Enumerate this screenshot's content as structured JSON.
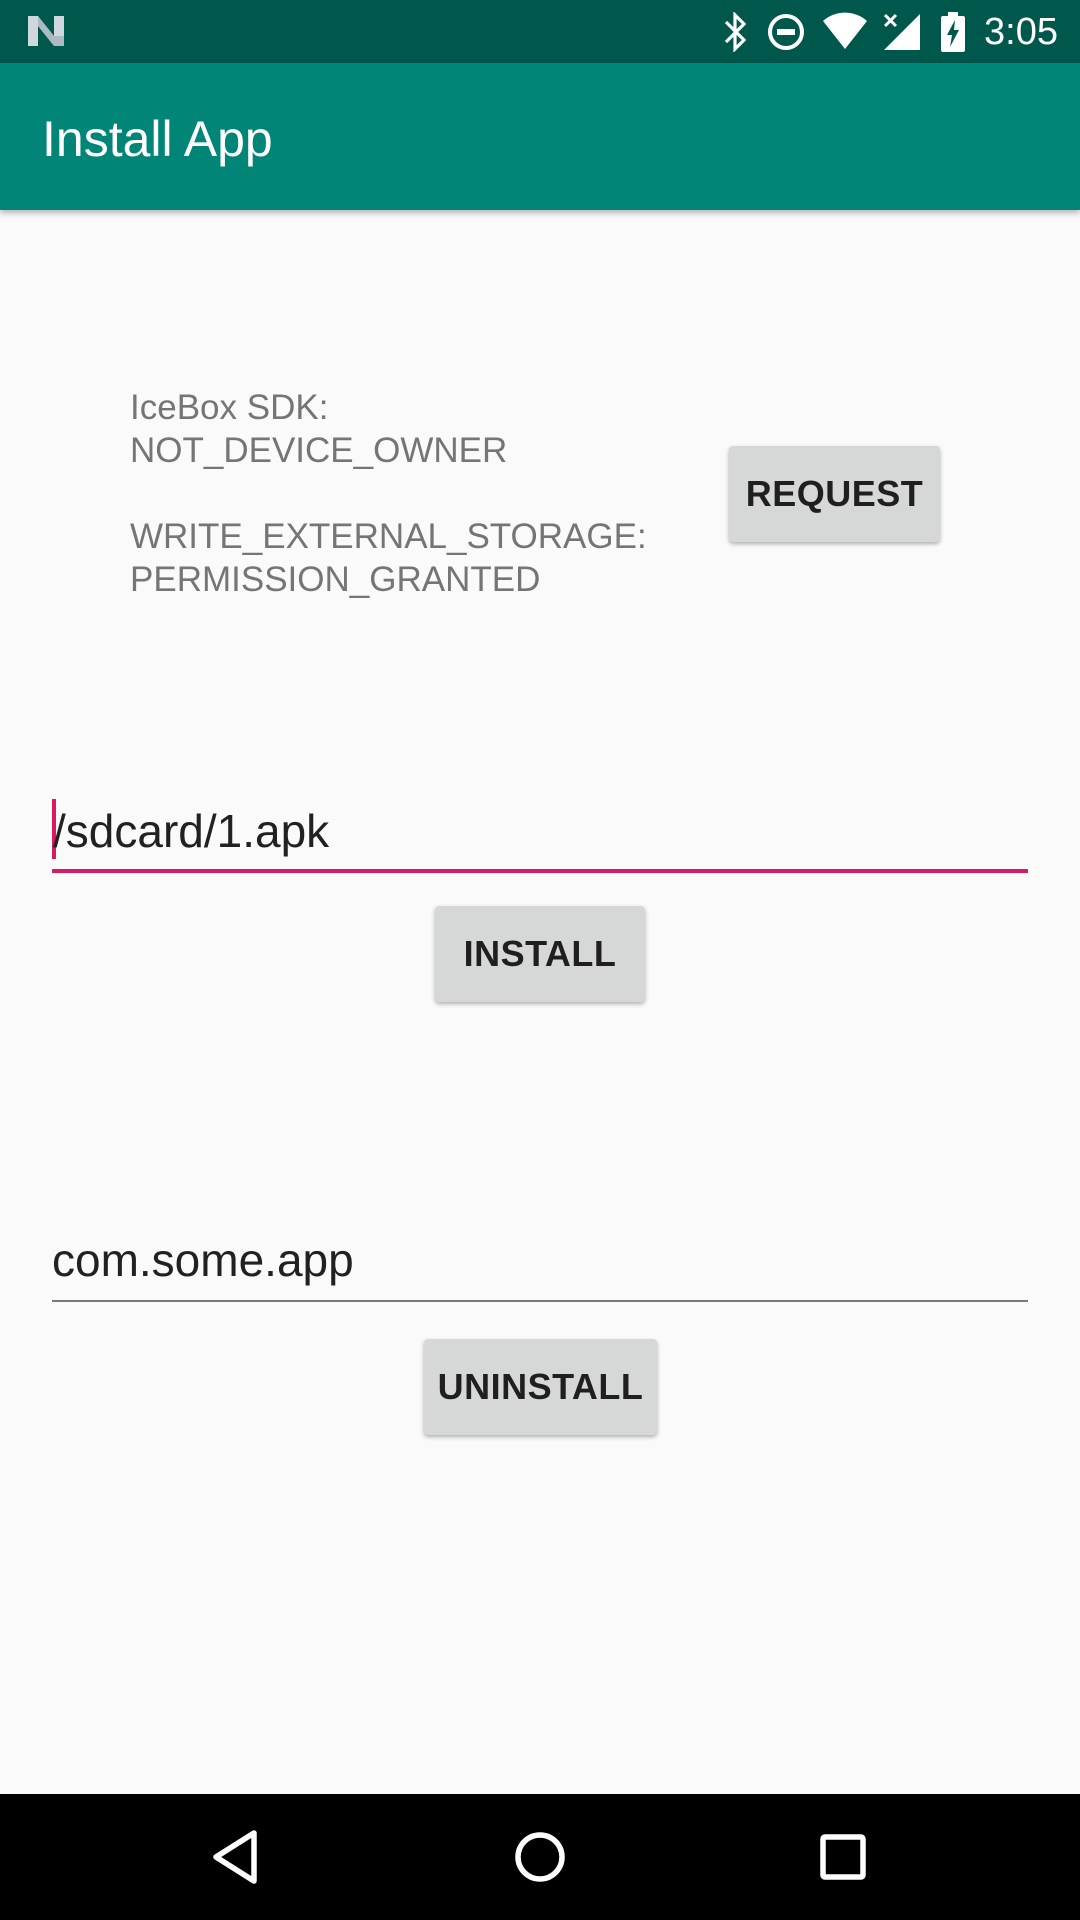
{
  "status_bar": {
    "time": "3:05",
    "icons": [
      "n-logo-icon",
      "bluetooth-icon",
      "do-not-disturb-icon",
      "wifi-icon",
      "cell-signal-icon",
      "battery-charging-icon"
    ]
  },
  "app_bar": {
    "title": "Install App"
  },
  "status_text": {
    "sdk_label": "IceBox SDK:",
    "sdk_value": "NOT_DEVICE_OWNER",
    "storage_label": "WRITE_EXTERNAL_STORAGE:",
    "storage_value": "PERMISSION_GRANTED"
  },
  "buttons": {
    "request": "REQUEST",
    "install": "INSTALL",
    "uninstall": "UNINSTALL"
  },
  "apk_path_field": {
    "value": "/sdcard/1.apk",
    "focused": true
  },
  "package_field": {
    "value": "com.some.app"
  },
  "nav_bar": {
    "icons": [
      "back-icon",
      "home-icon",
      "recents-icon"
    ]
  },
  "colors": {
    "status_bar": "#00574b",
    "app_bar": "#008577",
    "accent": "#d81b60",
    "background": "#fafafa",
    "button": "#d6d7d7"
  }
}
